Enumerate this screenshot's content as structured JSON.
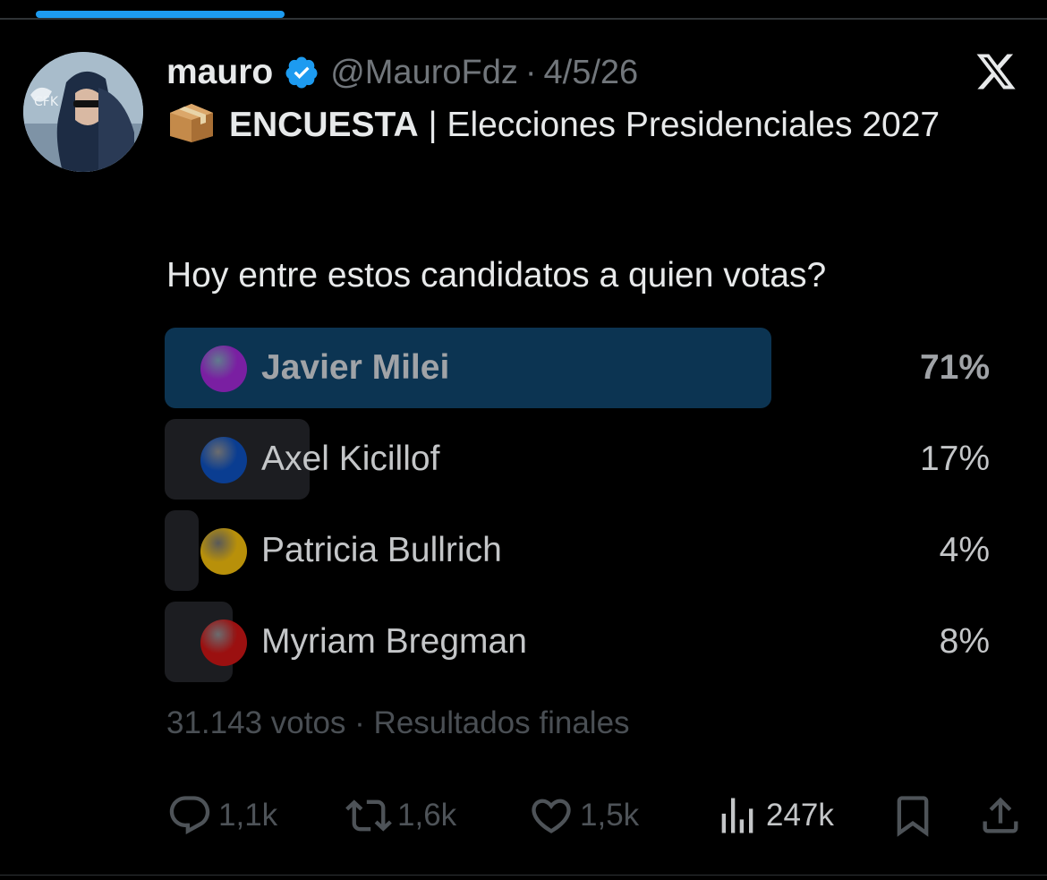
{
  "status": {
    "progress": 0.238
  },
  "post": {
    "author_name": "mauro",
    "handle": "@MauroFdz",
    "separator": "·",
    "date": "4/5/26",
    "title_emoji": "package-emoji",
    "title_strong": "ENCUESTA",
    "title_rest": " | Elecciones Presidenciales 2027",
    "question": "Hoy entre estos candidatos a quien votas?"
  },
  "poll": {
    "options": [
      {
        "label": "Javier Milei",
        "percent": "71%",
        "value": 71,
        "circle_color": "#7a1fa2",
        "winner": true
      },
      {
        "label": "Axel Kicillof",
        "percent": "17%",
        "value": 17,
        "circle_color": "#0a3d91",
        "winner": false
      },
      {
        "label": "Patricia Bullrich",
        "percent": "4%",
        "value": 4,
        "circle_color": "#b8900a",
        "winner": false
      },
      {
        "label": "Myriam Bregman",
        "percent": "8%",
        "value": 8,
        "circle_color": "#9b1010",
        "winner": false
      }
    ],
    "votes": "31.143 votos",
    "status": "Resultados finales"
  },
  "actions": {
    "replies": "1,1k",
    "reposts": "1,6k",
    "likes": "1,5k",
    "views": "247k"
  },
  "colors": {
    "accent": "#1d9bf0",
    "winner_bar": "#0c3452",
    "bar": "#1c1d21"
  }
}
